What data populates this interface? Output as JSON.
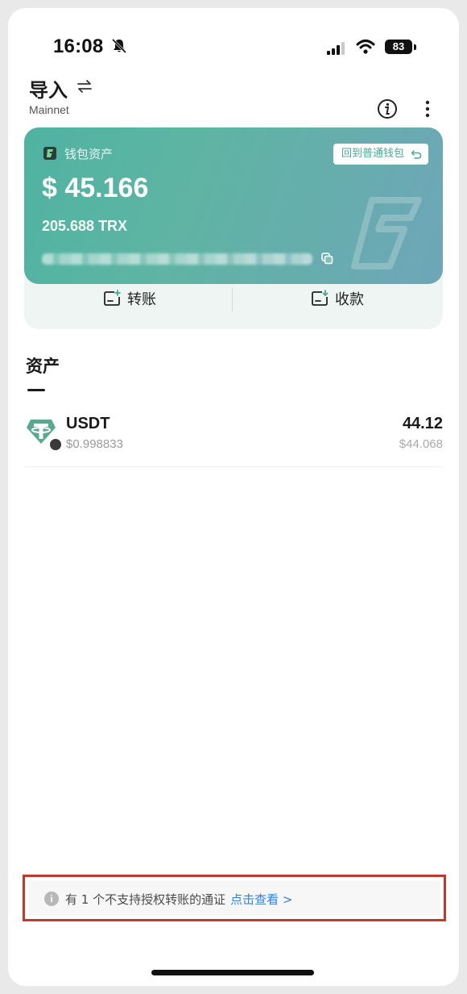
{
  "status_bar": {
    "time": "16:08",
    "battery": "83"
  },
  "header": {
    "wallet_name": "导入",
    "network": "Mainnet"
  },
  "asset_card": {
    "label": "钱包资产",
    "back_button": "回到普通钱包",
    "usd_balance": "$ 45.166",
    "trx_balance": "205.688 TRX"
  },
  "actions": {
    "transfer": "转账",
    "receive": "收款"
  },
  "assets_section": {
    "title": "资产",
    "items": [
      {
        "symbol": "USDT",
        "price": "$0.998833",
        "amount": "44.12",
        "value": "$44.068"
      }
    ]
  },
  "notice": {
    "text": "有 1 个不支持授权转账的通证",
    "link": "点击查看 >"
  },
  "colors": {
    "card_gradient_start": "#4fb3a2",
    "card_gradient_end": "#6ea6b8",
    "token_green": "#4aa896",
    "link_blue": "#3b7fdb",
    "highlight_red": "#c0392b"
  }
}
